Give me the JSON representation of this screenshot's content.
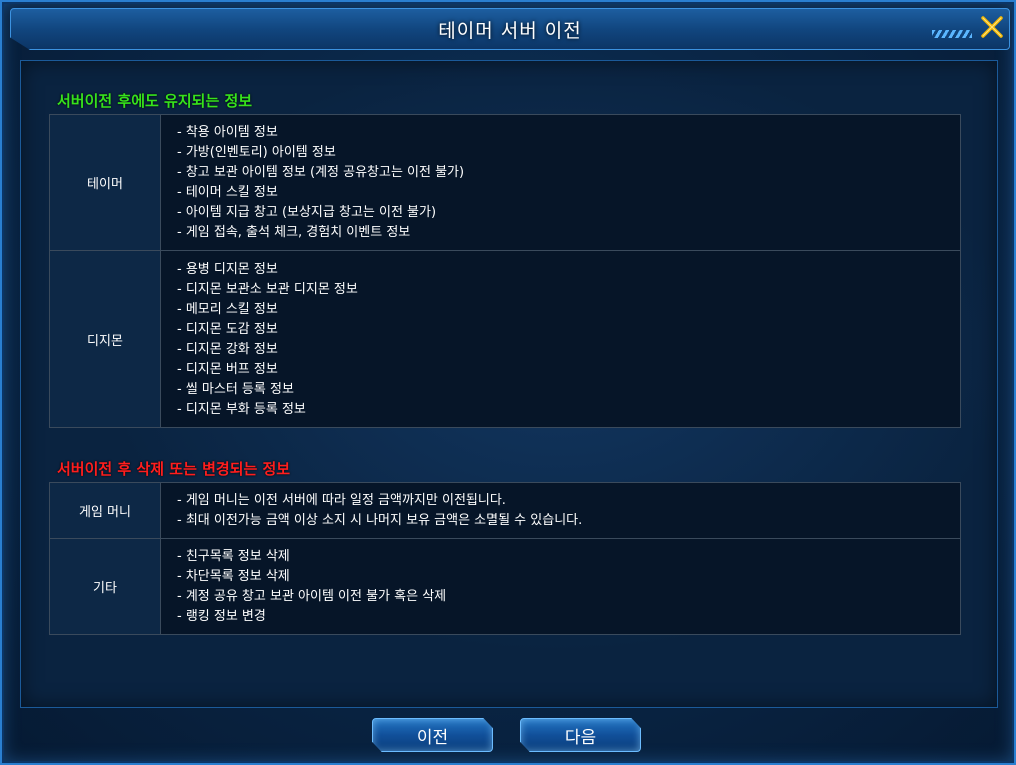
{
  "window": {
    "title": "테이머 서버 이전",
    "close_icon": "close-x-icon",
    "accent_color": "#2a7fd0",
    "close_color": "#f0b400"
  },
  "kept_section": {
    "title": "서버이전 후에도 유지되는 정보",
    "title_color": "#36e21c",
    "rows": [
      {
        "label": "테이머",
        "items": [
          "- 착용 아이템 정보",
          "- 가방(인벤토리) 아이템 정보",
          "- 창고 보관 아이템 정보 (계정 공유창고는 이전 불가)",
          "- 테이머 스킬 정보",
          "- 아이템 지급 창고 (보상지급 창고는 이전 불가)",
          "- 게임 접속, 출석 체크, 경험치 이벤트 정보"
        ]
      },
      {
        "label": "디지몬",
        "items": [
          "- 용병 디지몬 정보",
          "- 디지몬 보관소 보관 디지몬 정보",
          "- 메모리 스킬 정보",
          "- 디지몬 도감 정보",
          "- 디지몬 강화 정보",
          "- 디지몬 버프 정보",
          "- 씰 마스터 등록 정보",
          "- 디지몬 부화 등록 정보"
        ]
      }
    ]
  },
  "changed_section": {
    "title": "서버이전 후 삭제 또는 변경되는 정보",
    "title_color": "#ff1e1e",
    "rows": [
      {
        "label": "게임 머니",
        "items": [
          "- 게임 머니는 이전 서버에 따라 일정 금액까지만 이전됩니다.",
          "- 최대 이전가능 금액 이상 소지 시 나머지 보유 금액은 소멸될 수 있습니다."
        ]
      },
      {
        "label": "기타",
        "items": [
          "- 친구목록 정보 삭제",
          "- 차단목록 정보 삭제",
          "- 계정 공유 창고 보관 아이템 이전 불가 혹은 삭제",
          "- 랭킹 정보 변경"
        ]
      }
    ]
  },
  "footer": {
    "prev_label": "이전",
    "next_label": "다음"
  }
}
